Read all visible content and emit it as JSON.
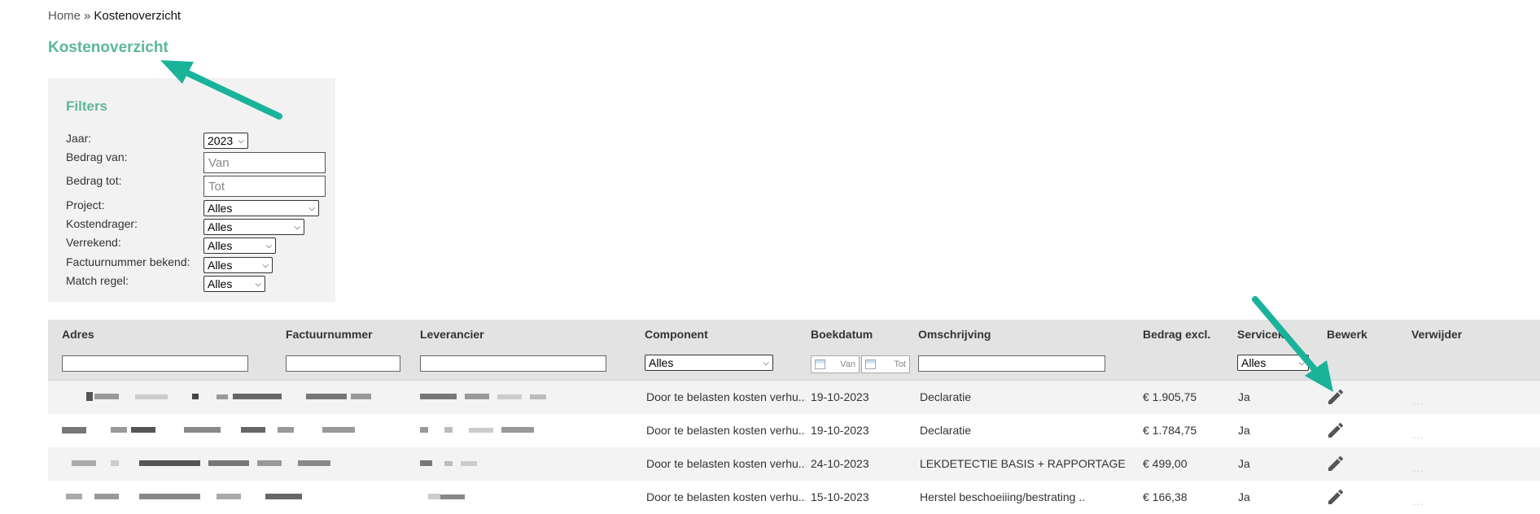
{
  "breadcrumb": {
    "home": "Home",
    "separator": "»",
    "current": "Kostenoverzicht"
  },
  "page_title": "Kostenoverzicht",
  "filters": {
    "title": "Filters",
    "jaar": {
      "label": "Jaar:",
      "value": "2023"
    },
    "bedrag_van": {
      "label": "Bedrag van:",
      "placeholder": "Van"
    },
    "bedrag_tot": {
      "label": "Bedrag tot:",
      "placeholder": "Tot"
    },
    "project": {
      "label": "Project:",
      "value": "Alles"
    },
    "kostendrager": {
      "label": "Kostendrager:",
      "value": "Alles"
    },
    "verrekend": {
      "label": "Verrekend:",
      "value": "Alles"
    },
    "factuurnummer_bekend": {
      "label": "Factuurnummer bekend:",
      "value": "Alles"
    },
    "match_regel": {
      "label": "Match regel:",
      "value": "Alles"
    }
  },
  "table": {
    "headers": {
      "adres": "Adres",
      "factuurnummer": "Factuurnummer",
      "leverancier": "Leverancier",
      "component": "Component",
      "boekdatum": "Boekdatum",
      "omschrijving": "Omschrijving",
      "bedrag": "Bedrag excl.",
      "service": "Servicek",
      "bewerk": "Bewerk",
      "verwijder": "Verwijder"
    },
    "column_filters": {
      "component": "Alles",
      "date_from": "Van",
      "date_to": "Tot",
      "service": "Alles"
    },
    "rows": [
      {
        "component": "Door te belasten kosten verhu...",
        "boekdatum": "19-10-2023",
        "omschrijving": "Declaratie",
        "bedrag": "€ 1.905,75",
        "service": "Ja"
      },
      {
        "component": "Door te belasten kosten verhu...",
        "boekdatum": "19-10-2023",
        "omschrijving": "Declaratie",
        "bedrag": "€ 1.784,75",
        "service": "Ja"
      },
      {
        "component": "Door te belasten kosten verhu...",
        "boekdatum": "24-10-2023",
        "omschrijving": "LEKDETECTIE BASIS + RAPPORTAGE",
        "bedrag": "€ 499,00",
        "service": "Ja"
      },
      {
        "component": "Door te belasten kosten verhu...",
        "boekdatum": "15-10-2023",
        "omschrijving": "Herstel beschoeiiing/bestrating ..",
        "bedrag": "€ 166,38",
        "service": "Ja"
      }
    ],
    "delete_icon": "…"
  },
  "colors": {
    "accent": "#5cb896",
    "arrow": "#19b39a",
    "header_bg": "#e3e3e3"
  }
}
